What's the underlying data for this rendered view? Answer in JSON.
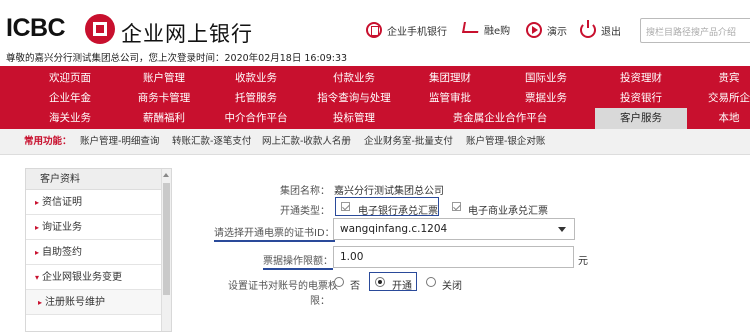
{
  "header": {
    "logo_text": "ICBC",
    "site_title": "企业网上银行",
    "welcome": "尊敬的嘉兴分行测试集团总公司，您上次登录时间：2020年02月18日 16:09:33",
    "tools": [
      "企业手机银行",
      "融e购",
      "演示",
      "退出"
    ],
    "search_placeholder": "搜栏目路径搜产品介绍"
  },
  "nav": {
    "rows": [
      [
        "欢迎页面",
        "账户管理",
        "收款业务",
        "付款业务",
        "集团理财",
        "国际业务",
        "投资理财",
        "贵宾"
      ],
      [
        "企业年金",
        "商务卡管理",
        "托管服务",
        "指令查询与处理",
        "监管审批",
        "票据业务",
        "投资银行",
        "交易所企"
      ],
      [
        "海关业务",
        "薪酬福利",
        "中介合作平台",
        "投标管理",
        "贵金属企业合作平台",
        "客户服务",
        "本地"
      ]
    ],
    "active": "客户服务"
  },
  "quick": {
    "label": "常用功能：",
    "items": [
      "账户管理-明细查询",
      "转账汇款-逐笔支付",
      "网上汇款-收款人名册",
      "企业财务室-批量支付",
      "账户管理-银企对账"
    ]
  },
  "sidebar": {
    "head": "客户资料",
    "items": [
      "资信证明",
      "询证业务",
      "自助签约",
      "企业网银业务变更"
    ],
    "sub_items": [
      "注册账号维护"
    ]
  },
  "form": {
    "group_label": "集团名称：",
    "group_value": "嘉兴分行测试集团总公司",
    "open_type_label": "开通类型：",
    "open_type_options": [
      "电子银行承兑汇票",
      "电子商业承兑汇票"
    ],
    "cert_label": "请选择开通电票的证书ID：",
    "cert_value": "wangqinfang.c.1204",
    "limit_label": "票据操作限额：",
    "limit_value": "1.00",
    "limit_unit": "元",
    "perm_label_line1": "设置证书对账号的电票权",
    "perm_label_line2": "限：",
    "perm_options": [
      "否",
      "开通",
      "关闭"
    ],
    "perm_selected": "开通"
  },
  "colors": {
    "brand": "#c8102e",
    "highlight": "#2a4a9a"
  }
}
